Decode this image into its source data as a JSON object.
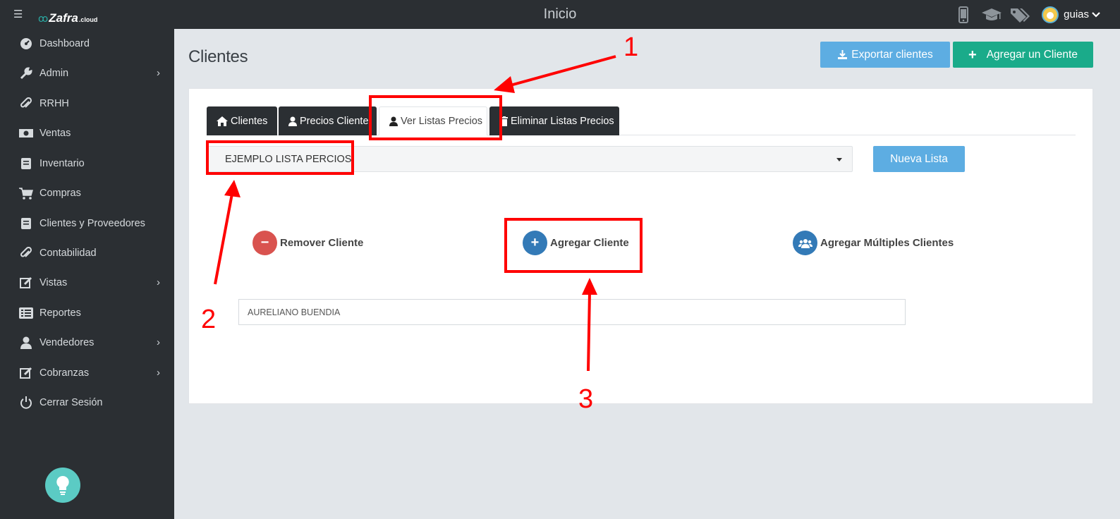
{
  "app": {
    "logo_name": "Zafra",
    "logo_tld": ".cloud",
    "page_heading": "Inicio",
    "user": "guias"
  },
  "top_icons": [
    "mobile-icon",
    "graduation-cap-icon",
    "tags-icon"
  ],
  "sidebar": {
    "items": [
      {
        "label": "Dashboard",
        "icon": "dashboard-icon",
        "has_children": false
      },
      {
        "label": "Admin",
        "icon": "wrench-icon",
        "has_children": true
      },
      {
        "label": "RRHH",
        "icon": "paperclip-icon",
        "has_children": false
      },
      {
        "label": "Ventas",
        "icon": "money-icon",
        "has_children": false
      },
      {
        "label": "Inventario",
        "icon": "book-icon",
        "has_children": false
      },
      {
        "label": "Compras",
        "icon": "cart-icon",
        "has_children": false
      },
      {
        "label": "Clientes y Proveedores",
        "icon": "book-icon",
        "has_children": false
      },
      {
        "label": "Contabilidad",
        "icon": "paperclip-icon",
        "has_children": false
      },
      {
        "label": "Vistas",
        "icon": "edit-icon",
        "has_children": true
      },
      {
        "label": "Reportes",
        "icon": "list-icon",
        "has_children": false
      },
      {
        "label": "Vendedores",
        "icon": "user-icon",
        "has_children": true
      },
      {
        "label": "Cobranzas",
        "icon": "edit-icon",
        "has_children": true
      },
      {
        "label": "Cerrar Sesión",
        "icon": "power-icon",
        "has_children": false
      }
    ]
  },
  "main": {
    "title": "Clientes",
    "export_label": "Exportar clientes",
    "add_label": "Agregar un Cliente",
    "tabs": [
      {
        "label": "Clientes",
        "icon": "home-icon",
        "active": false
      },
      {
        "label": "Precios Cliente",
        "icon": "user-icon",
        "active": false
      },
      {
        "label": "Ver Listas Precios",
        "icon": "user-icon",
        "active": true
      },
      {
        "label": "Eliminar Listas Precios",
        "icon": "trash-icon",
        "active": false
      }
    ],
    "price_list_selected": "EJEMPLO LISTA PERCIOS",
    "new_list_label": "Nueva Lista",
    "actions": {
      "remove": "Remover Cliente",
      "add": "Agregar Cliente",
      "add_multiple": "Agregar Múltiples Clientes"
    },
    "client_value": "AURELIANO BUENDIA"
  },
  "annotations": {
    "one": "1",
    "two": "2",
    "three": "3",
    "color": "#ff0000"
  },
  "colors": {
    "sidebar_bg": "#2b2f33",
    "primary_light": "#5dade2",
    "success": "#1aab8a",
    "danger": "#d9534f",
    "info": "#337ab7"
  }
}
